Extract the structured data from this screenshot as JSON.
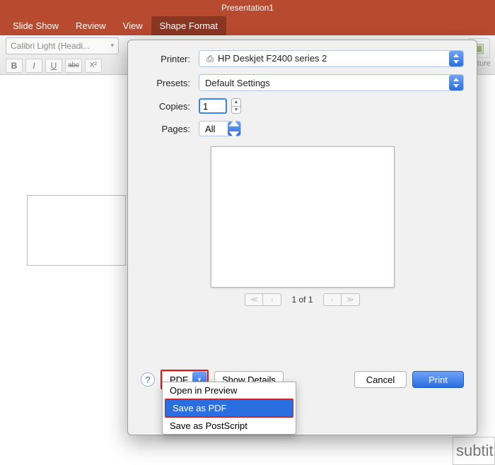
{
  "window": {
    "title": "Presentation1"
  },
  "ribbon": {
    "tabs": {
      "slide_show": "Slide Show",
      "review": "Review",
      "view": "View",
      "shape_format": "Shape Format"
    }
  },
  "toolbar": {
    "font": "Calibri Light (Headi...",
    "bold": "B",
    "italic": "I",
    "underline": "U",
    "strike": "abc",
    "super": "X²",
    "picture_label": "Picture"
  },
  "canvas_placeholder": "subtit",
  "print": {
    "labels": {
      "printer": "Printer:",
      "presets": "Presets:",
      "copies": "Copies:",
      "pages": "Pages:"
    },
    "printer_value": "HP Deskjet F2400 series 2",
    "presets_value": "Default Settings",
    "copies_value": "1",
    "pages_value": "All",
    "page_indicator": "1 of 1",
    "pdf_label": "PDF",
    "show_details": "Show Details",
    "cancel": "Cancel",
    "print": "Print",
    "menu": {
      "open_preview": "Open in Preview",
      "save_pdf": "Save as PDF",
      "save_ps": "Save as PostScript"
    }
  }
}
